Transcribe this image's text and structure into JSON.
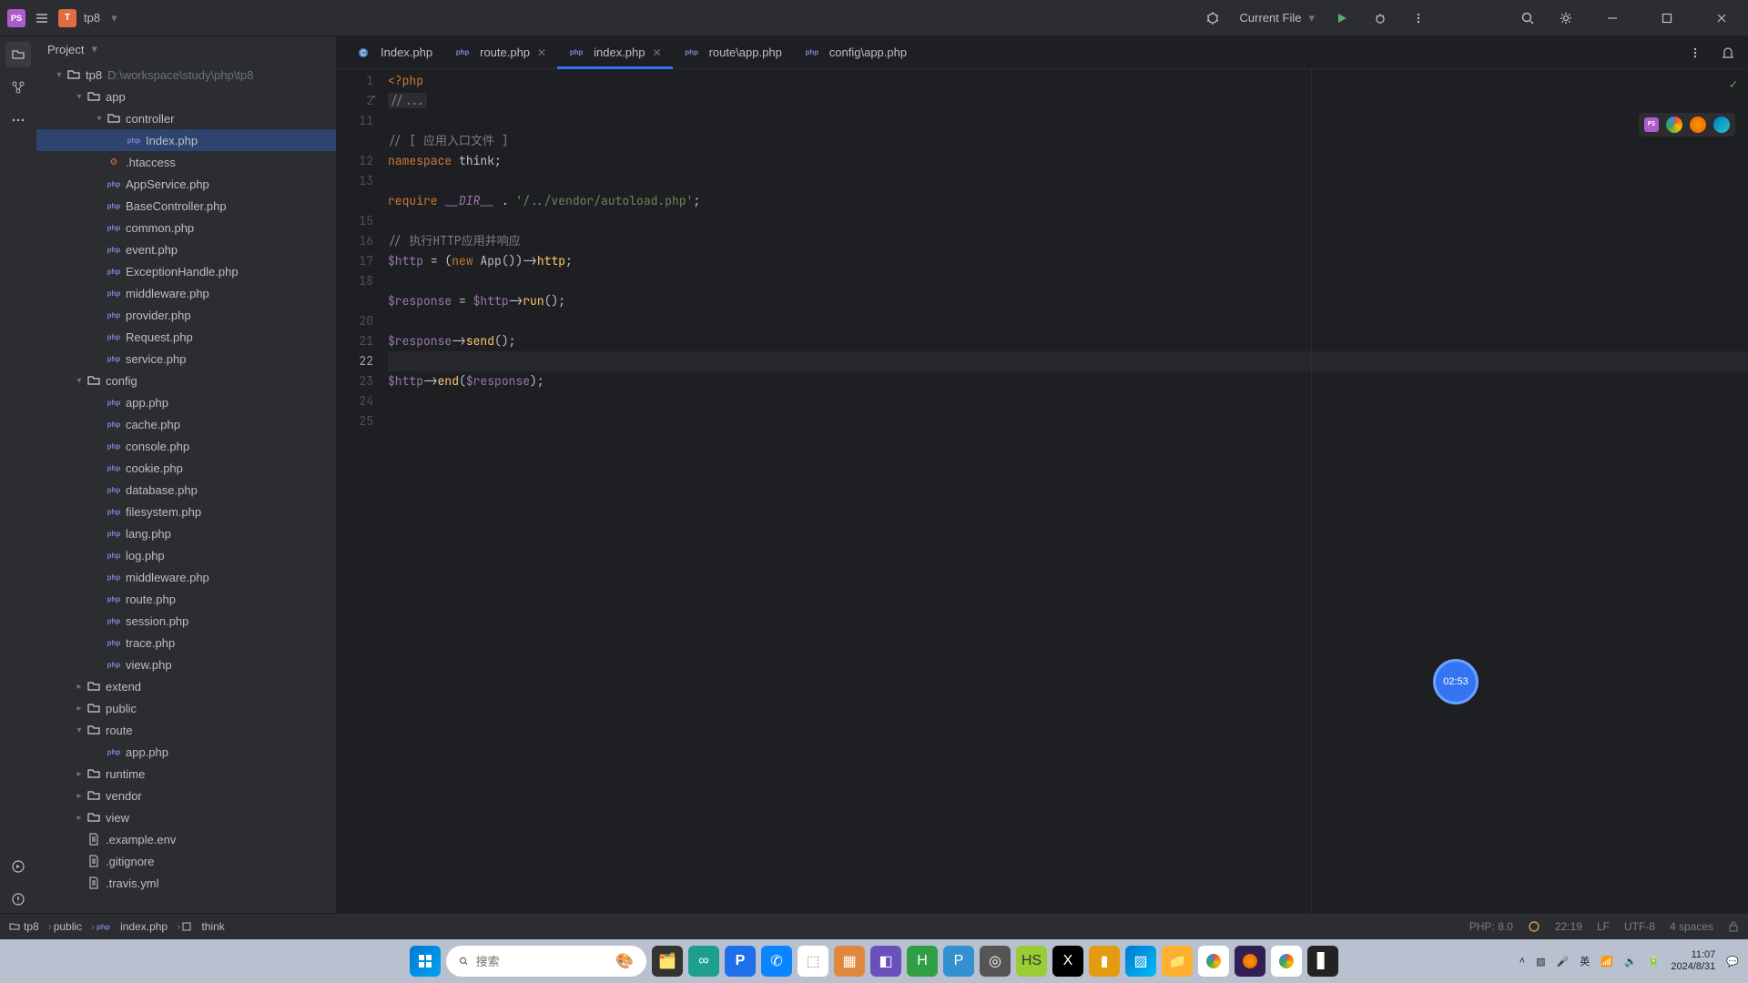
{
  "titlebar": {
    "project_name": "tp8",
    "run_config": "Current File"
  },
  "project": {
    "label": "Project",
    "root": {
      "name": "tp8",
      "path": "D:\\workspace\\study\\php\\tp8"
    },
    "tree": [
      {
        "depth": 1,
        "chev": "▾",
        "icon": "folder",
        "label": "app"
      },
      {
        "depth": 2,
        "chev": "▾",
        "icon": "folder",
        "label": "controller"
      },
      {
        "depth": 3,
        "chev": "",
        "icon": "php",
        "label": "Index.php",
        "selected": true
      },
      {
        "depth": 2,
        "chev": "",
        "icon": "hta",
        "label": ".htaccess"
      },
      {
        "depth": 2,
        "chev": "",
        "icon": "php",
        "label": "AppService.php"
      },
      {
        "depth": 2,
        "chev": "",
        "icon": "php",
        "label": "BaseController.php"
      },
      {
        "depth": 2,
        "chev": "",
        "icon": "php",
        "label": "common.php"
      },
      {
        "depth": 2,
        "chev": "",
        "icon": "php",
        "label": "event.php"
      },
      {
        "depth": 2,
        "chev": "",
        "icon": "php",
        "label": "ExceptionHandle.php"
      },
      {
        "depth": 2,
        "chev": "",
        "icon": "php",
        "label": "middleware.php"
      },
      {
        "depth": 2,
        "chev": "",
        "icon": "php",
        "label": "provider.php"
      },
      {
        "depth": 2,
        "chev": "",
        "icon": "php",
        "label": "Request.php"
      },
      {
        "depth": 2,
        "chev": "",
        "icon": "php",
        "label": "service.php"
      },
      {
        "depth": 1,
        "chev": "▾",
        "icon": "folder",
        "label": "config"
      },
      {
        "depth": 2,
        "chev": "",
        "icon": "php",
        "label": "app.php"
      },
      {
        "depth": 2,
        "chev": "",
        "icon": "php",
        "label": "cache.php"
      },
      {
        "depth": 2,
        "chev": "",
        "icon": "php",
        "label": "console.php"
      },
      {
        "depth": 2,
        "chev": "",
        "icon": "php",
        "label": "cookie.php"
      },
      {
        "depth": 2,
        "chev": "",
        "icon": "php",
        "label": "database.php"
      },
      {
        "depth": 2,
        "chev": "",
        "icon": "php",
        "label": "filesystem.php"
      },
      {
        "depth": 2,
        "chev": "",
        "icon": "php",
        "label": "lang.php"
      },
      {
        "depth": 2,
        "chev": "",
        "icon": "php",
        "label": "log.php"
      },
      {
        "depth": 2,
        "chev": "",
        "icon": "php",
        "label": "middleware.php"
      },
      {
        "depth": 2,
        "chev": "",
        "icon": "php",
        "label": "route.php"
      },
      {
        "depth": 2,
        "chev": "",
        "icon": "php",
        "label": "session.php"
      },
      {
        "depth": 2,
        "chev": "",
        "icon": "php",
        "label": "trace.php"
      },
      {
        "depth": 2,
        "chev": "",
        "icon": "php",
        "label": "view.php"
      },
      {
        "depth": 1,
        "chev": "▸",
        "icon": "folder",
        "label": "extend"
      },
      {
        "depth": 1,
        "chev": "▸",
        "icon": "folder",
        "label": "public"
      },
      {
        "depth": 1,
        "chev": "▾",
        "icon": "folder",
        "label": "route"
      },
      {
        "depth": 2,
        "chev": "",
        "icon": "php",
        "label": "app.php"
      },
      {
        "depth": 1,
        "chev": "▸",
        "icon": "folder",
        "label": "runtime"
      },
      {
        "depth": 1,
        "chev": "▸",
        "icon": "folder",
        "label": "vendor"
      },
      {
        "depth": 1,
        "chev": "▸",
        "icon": "folder",
        "label": "view"
      },
      {
        "depth": 1,
        "chev": "",
        "icon": "text",
        "label": ".example.env"
      },
      {
        "depth": 1,
        "chev": "",
        "icon": "text",
        "label": ".gitignore"
      },
      {
        "depth": 1,
        "chev": "",
        "icon": "text",
        "label": ".travis.yml"
      }
    ]
  },
  "tabs": [
    {
      "label": "Index.php",
      "icon": "class",
      "close": false
    },
    {
      "label": "route.php",
      "icon": "php",
      "close": true
    },
    {
      "label": "index.php",
      "icon": "php",
      "close": true,
      "active": true
    },
    {
      "label": "route\\app.php",
      "icon": "php",
      "close": false
    },
    {
      "label": "config\\app.php",
      "icon": "php",
      "close": false
    }
  ],
  "editor": {
    "gutter": [
      "1",
      "2",
      "11",
      "",
      "12",
      "13",
      "",
      "15",
      "16",
      "17",
      "18",
      "",
      "20",
      "21",
      "22",
      "23",
      "24",
      "25"
    ],
    "current_line_index": 14,
    "lines": [
      [
        {
          "c": "k-tag",
          "t": "<?php"
        }
      ],
      [
        {
          "c": "k-comment-box",
          "t": "//..."
        }
      ],
      [],
      [
        {
          "c": "k-comment",
          "t": "// [ 应用入口文件 ]"
        }
      ],
      [
        {
          "c": "k-key",
          "t": "namespace "
        },
        {
          "c": "k-type",
          "t": "think"
        },
        {
          "c": "",
          "t": ";"
        }
      ],
      [],
      [
        {
          "c": "k-key",
          "t": "require "
        },
        {
          "c": "k-const",
          "t": "__DIR__"
        },
        {
          "c": "",
          "t": " . "
        },
        {
          "c": "k-str",
          "t": "'/../vendor/autoload.php'"
        },
        {
          "c": "",
          "t": ";"
        }
      ],
      [],
      [
        {
          "c": "k-comment",
          "t": "// 执行HTTP应用并响应"
        }
      ],
      [
        {
          "c": "k-var",
          "t": "$http"
        },
        {
          "c": "",
          "t": " = ("
        },
        {
          "c": "k-key",
          "t": "new "
        },
        {
          "c": "k-type",
          "t": "App"
        },
        {
          "c": "",
          "t": "())->"
        },
        {
          "c": "k-fn",
          "t": "http"
        },
        {
          "c": "",
          "t": ";"
        }
      ],
      [],
      [
        {
          "c": "k-var",
          "t": "$response"
        },
        {
          "c": "",
          "t": " = "
        },
        {
          "c": "k-var",
          "t": "$http"
        },
        {
          "c": "",
          "t": "->"
        },
        {
          "c": "k-fn",
          "t": "run"
        },
        {
          "c": "",
          "t": "();"
        }
      ],
      [],
      [
        {
          "c": "k-var",
          "t": "$response"
        },
        {
          "c": "",
          "t": "->"
        },
        {
          "c": "k-fn",
          "t": "send"
        },
        {
          "c": "",
          "t": "();"
        }
      ],
      [],
      [
        {
          "c": "k-var",
          "t": "$http"
        },
        {
          "c": "",
          "t": "->"
        },
        {
          "c": "k-fn",
          "t": "end"
        },
        {
          "c": "",
          "t": "("
        },
        {
          "c": "k-var",
          "t": "$response"
        },
        {
          "c": "",
          "t": ");"
        }
      ],
      []
    ],
    "namespace_hint": "\\think"
  },
  "timer": "02:53",
  "breadcrumbs": [
    "tp8",
    "public",
    "index.php",
    "think"
  ],
  "status": {
    "php": "PHP: 8.0",
    "pos": "22:19",
    "sep": "LF",
    "enc": "UTF-8",
    "indent": "4 spaces"
  },
  "taskbar": {
    "search_placeholder": "搜索",
    "time": "11:07",
    "date": "2024/8/31"
  }
}
